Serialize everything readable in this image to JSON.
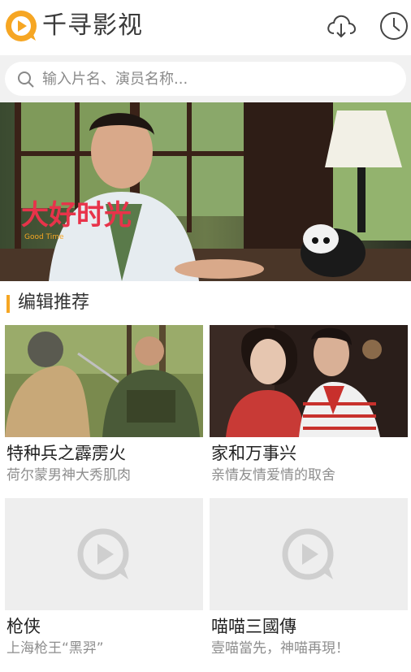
{
  "header": {
    "app_title": "千寻影视",
    "logo_icon": "qianxun-logo-icon",
    "download_icon": "cloud-download-icon",
    "history_icon": "clock-icon"
  },
  "search": {
    "placeholder": "输入片名、演员名称..."
  },
  "banner": {
    "logo_text": "大好时光",
    "logo_subtext": "Good Time",
    "dot_count": 4,
    "active_dot": 0
  },
  "section": {
    "title": "编辑推荐"
  },
  "cards": [
    {
      "title": "特种兵之霹雳火",
      "subtitle": "荷尔蒙男神大秀肌肉",
      "has_image": true
    },
    {
      "title": "家和万事兴",
      "subtitle": "亲情友情爱情的取舍",
      "has_image": true
    },
    {
      "title": "枪侠",
      "subtitle": "上海枪王“黑羿”",
      "has_image": false
    },
    {
      "title": "喵喵三國傳",
      "subtitle": "壹喵當先，神喵再現！",
      "has_image": false
    }
  ],
  "colors": {
    "accent": "#f6a623",
    "search_bg": "#f1f1f1",
    "subtitle": "#8e8e8e"
  }
}
